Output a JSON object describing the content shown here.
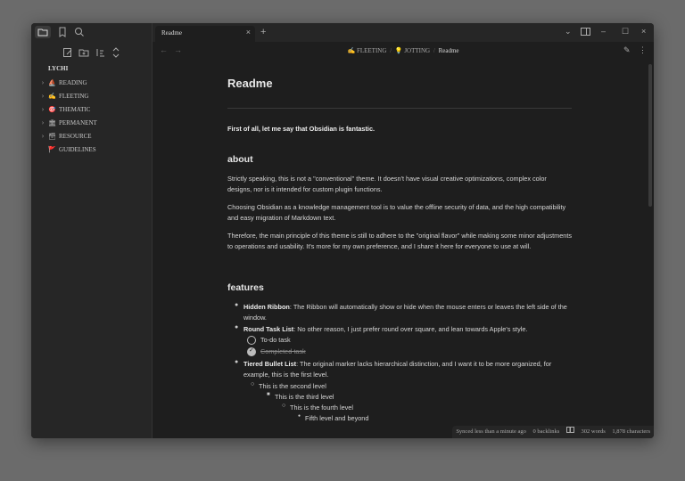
{
  "sidebar": {
    "vault_name": "LYCHI",
    "items": [
      {
        "emoji": "⛵",
        "label": "READING",
        "has_children": true
      },
      {
        "emoji": "✍",
        "label": "FLEETING",
        "has_children": true
      },
      {
        "emoji": "🎯",
        "label": "THEMATIC",
        "has_children": true
      },
      {
        "emoji": "🏛",
        "label": "PERMANENT",
        "has_children": true
      },
      {
        "emoji": "🗃",
        "label": "RESOURCE",
        "has_children": true
      },
      {
        "emoji": "🚩",
        "label": "GUIDELINES",
        "has_children": false
      }
    ]
  },
  "tabs": {
    "active_title": "Readme"
  },
  "breadcrumb": {
    "parts": [
      {
        "emoji": "✍",
        "label": "FLEETING"
      },
      {
        "emoji": "💡",
        "label": "JOTTING"
      }
    ],
    "current": "Readme"
  },
  "doc": {
    "title": "Readme",
    "intro": "First of all, let me say that Obsidian is fantastic.",
    "about_heading": "about",
    "about_p1": "Strictly speaking, this is not a \"conventional\" theme. It doesn't have visual creative optimizations, complex color designs, nor is it intended for custom plugin functions.",
    "about_p2": "Choosing Obsidian as a knowledge management tool is to value the offline security of data, and the high compatibility and easy migration of Markdown text.",
    "about_p3": "Therefore, the main principle of this theme is still to adhere to the \"original flavor\" while making some minor adjustments to operations and usability. It's more for my own preference, and I share it here for everyone to use at will.",
    "features_heading": "features",
    "f1_bold": "Hidden Ribbon",
    "f1_text": ": The Ribbon will automatically show or hide when the mouse enters or leaves the left side of the window.",
    "f2_bold": "Round Task List",
    "f2_text": ": No other reason, I just prefer round over square, and lean towards Apple's style.",
    "task_todo": "To-do task",
    "task_done": "Completed task",
    "f3_bold": "Tiered Bullet List",
    "f3_text": ": The original marker lacks hierarchical distinction, and I want it to be more organized, for example, this is the first level.",
    "level2": "This is the second level",
    "level3": "This is the third level",
    "level4": "This is the fourth level",
    "level5": "Fifth level and beyond"
  },
  "status": {
    "sync": "Synced less than a minute ago",
    "backlinks": "0 backlinks",
    "words": "302 words",
    "chars": "1,878 characters"
  },
  "colors": {
    "background": "#6b6b6b",
    "window": "#1e1e1e",
    "sidebar": "#262626",
    "text": "#dcdcdc"
  }
}
